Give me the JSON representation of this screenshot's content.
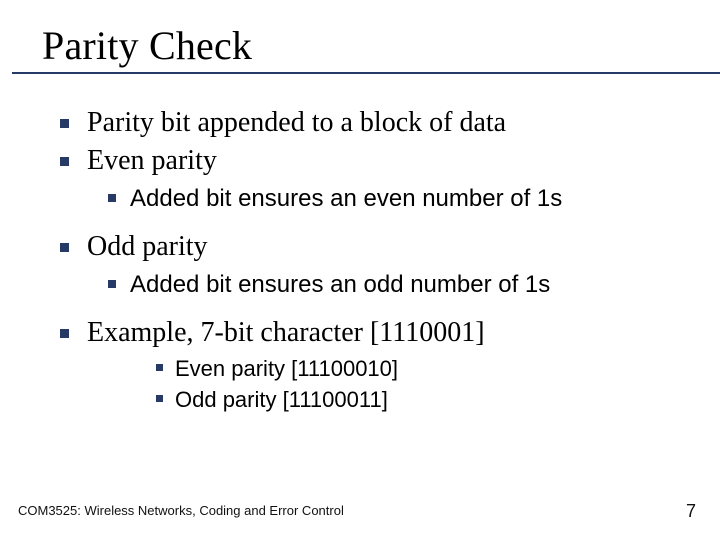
{
  "slide": {
    "title": "Parity Check",
    "bullets": {
      "b1": "Parity bit appended to a block of data",
      "b2": "Even parity",
      "b2a": "Added bit ensures an even number of 1s",
      "b3": "Odd parity",
      "b3a": "Added bit ensures an odd number of 1s",
      "b4": "Example, 7-bit character [1110001]",
      "b4a": "Even parity [11100010]",
      "b4b": "Odd parity [11100011]"
    },
    "footer": "COM3525: Wireless Networks, Coding and Error Control",
    "page_number": "7"
  }
}
